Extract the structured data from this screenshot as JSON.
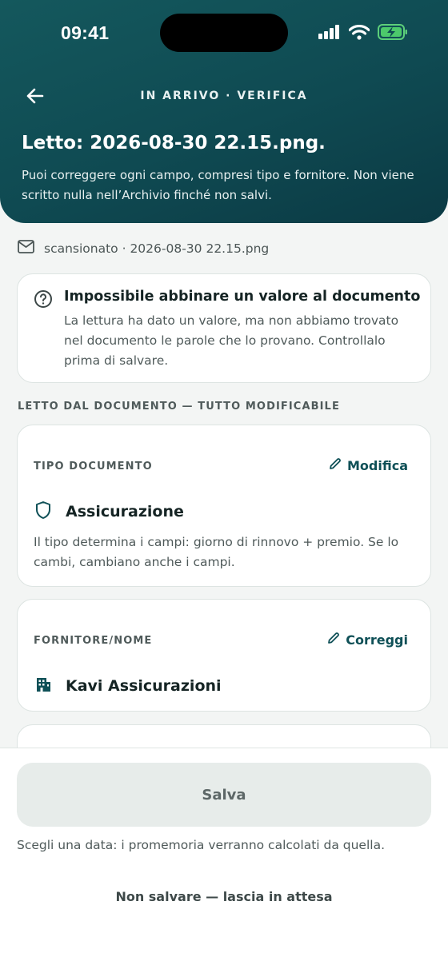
{
  "status_bar": {
    "time": "09:41"
  },
  "header": {
    "nav_title": "IN ARRIVO · VERIFICA",
    "title": "Letto: 2026-08-30 22.15.png.",
    "subtitle": "Puoi correggere ogni campo, compresi tipo e fornitore. Non viene scritto nulla nell’Archivio finché non salvi."
  },
  "source": {
    "text": "scansionato · 2026-08-30 22.15.png",
    "icon": "mail-icon"
  },
  "alert": {
    "title": "Impossibile abbinare un valore al documento",
    "body": "La lettura ha dato un valore, ma non abbiamo trovato nel documento le parole che lo provano. Controllalo prima di salvare."
  },
  "section_label": "LETTO DAL DOCUMENTO — TUTTO MODIFICABILE",
  "fields": [
    {
      "label": "TIPO DOCUMENTO",
      "action": "Modifica",
      "value": "Assicurazione",
      "icon": "shield-icon",
      "help": "Il tipo determina i campi: giorno di rinnovo + premio. Se lo cambi, cambiano anche i campi."
    },
    {
      "label": "FORNITORE/NOME",
      "action": "Correggi",
      "value": "Kavi Assicurazioni",
      "icon": "building-icon"
    }
  ],
  "footer": {
    "save_label": "Salva",
    "hint": "Scegli una data: i promemoria verranno calcolati da quella.",
    "later_label": "Non salvare — lascia in attesa"
  },
  "colors": {
    "header": "#0f4a52",
    "accent": "#0f5057",
    "background": "#f3f5f4"
  }
}
